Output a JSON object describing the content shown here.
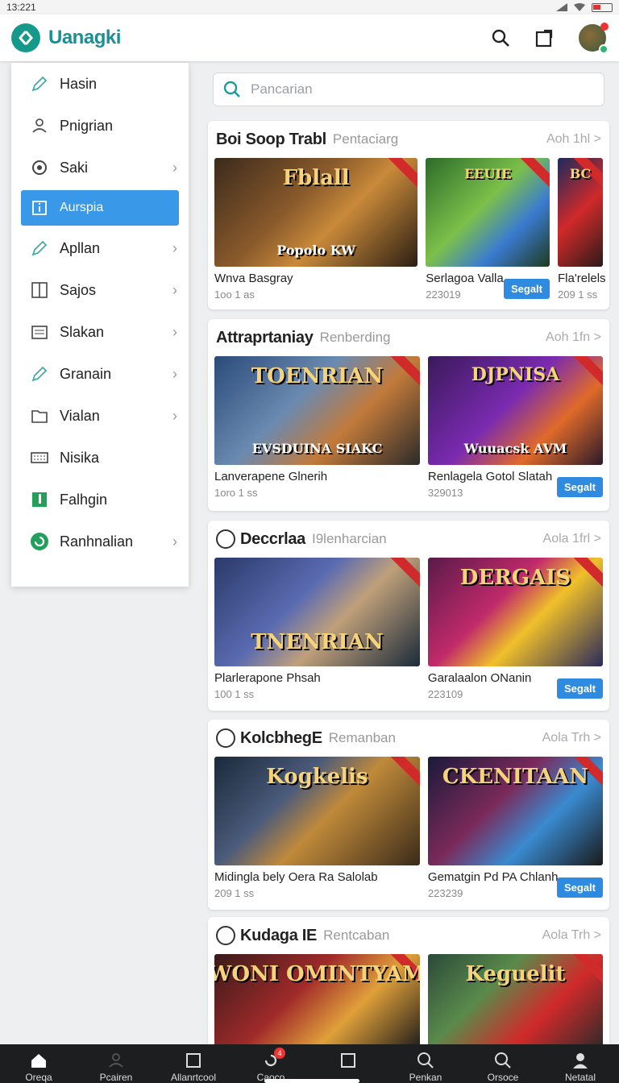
{
  "status": {
    "time": "13:221"
  },
  "app": {
    "title": "Uanagki"
  },
  "search": {
    "placeholder": "Pancarian"
  },
  "sidebar": {
    "items": [
      {
        "label": "Hasin",
        "icon": "pencil-icon",
        "chevron": false
      },
      {
        "label": "Pnigrian",
        "icon": "user-icon",
        "chevron": false
      },
      {
        "label": "Saki",
        "icon": "gear-icon",
        "chevron": true
      },
      {
        "label": "Aurspia",
        "icon": "info-box-icon",
        "chevron": false,
        "active": true
      },
      {
        "label": "Apllan",
        "icon": "pencil-icon",
        "chevron": true
      },
      {
        "label": "Sajos",
        "icon": "columns-icon",
        "chevron": true
      },
      {
        "label": "Slakan",
        "icon": "document-icon",
        "chevron": true
      },
      {
        "label": "Granain",
        "icon": "pencil-icon",
        "chevron": true
      },
      {
        "label": "Vialan",
        "icon": "folder-icon",
        "chevron": true
      },
      {
        "label": "Nisika",
        "icon": "keyboard-icon",
        "chevron": false
      },
      {
        "label": "Falhgin",
        "icon": "flag-icon",
        "chevron": false
      },
      {
        "label": "Ranhnalian",
        "icon": "refresh-icon",
        "chevron": true
      }
    ]
  },
  "sections": [
    {
      "title": "Boi Soop Trabl",
      "subtitle": "Pentaciarg",
      "more": "Aoh 1hl >",
      "cards": [
        {
          "name": "Wnva Basgray",
          "meta": "1oo 1 as",
          "art": "Fblall",
          "art2": "Popolo KW",
          "button": ""
        },
        {
          "name": "Serlagoa Valla",
          "meta": "223019",
          "art": "EEUIE",
          "art2": "",
          "button": "Segalt"
        },
        {
          "name": "Fla'relels",
          "meta": "209 1 ss",
          "art": "BC",
          "art2": "",
          "button": ""
        }
      ]
    },
    {
      "title": "Attraprtaniay",
      "subtitle": "Renberding",
      "more": "Aoh 1fn >",
      "cards": [
        {
          "name": "Lanverapene Glnerih",
          "meta": "1oro 1 ss",
          "art": "TOENRIAN",
          "art2": "EVSDUINA SIAKC",
          "button": ""
        },
        {
          "name": "Renlagela Gotol Slatah",
          "meta": "329013",
          "art": "DJPNISA",
          "art2": "Wuuacsk AVM",
          "button": "Segalt"
        }
      ]
    },
    {
      "title": "Deccrlaa",
      "subtitle": "I9lenharcian",
      "more": "Aola 1frl >",
      "cards": [
        {
          "name": "Plarlerapone Phsah",
          "meta": "100 1 ss",
          "art": "TNENRIAN",
          "art2": "",
          "button": ""
        },
        {
          "name": "Garalaalon ONanin",
          "meta": "223109",
          "art": "DERGAIS",
          "art2": "",
          "button": "Segalt"
        }
      ]
    },
    {
      "title": "KolcbhegE",
      "subtitle": "Remanban",
      "more": "Aola Trh >",
      "cards": [
        {
          "name": "Midingla bely Oera Ra Salolab",
          "meta": "209 1 ss",
          "art": "Kogkelis",
          "art2": "",
          "button": ""
        },
        {
          "name": "Gematgin Pd PA Chlanh",
          "meta": "223239",
          "art": "CKENITAAN",
          "art2": "",
          "button": "Segalt"
        }
      ]
    },
    {
      "title": "Kudaga IE",
      "subtitle": "Rentcaban",
      "more": "Aola Trh >",
      "cards": [
        {
          "name": "",
          "meta": "",
          "art": "DWONI OMINTYAMN",
          "art2": "",
          "button": ""
        },
        {
          "name": "",
          "meta": "",
          "art": "Keguelit",
          "art2": "",
          "button": ""
        }
      ]
    }
  ],
  "bottom_nav": [
    {
      "label": "Oreqa",
      "icon": "home-icon"
    },
    {
      "label": "Pcairen",
      "icon": "user-icon"
    },
    {
      "label": "Allanrtcool",
      "icon": "square-icon"
    },
    {
      "label": "Caoco",
      "icon": "refresh-icon",
      "badge": "4"
    },
    {
      "label": "",
      "icon": "square-icon"
    },
    {
      "label": "Penkan",
      "icon": "search-icon"
    },
    {
      "label": "Orsoce",
      "icon": "search-icon"
    },
    {
      "label": "Netatal",
      "icon": "person-icon"
    }
  ]
}
